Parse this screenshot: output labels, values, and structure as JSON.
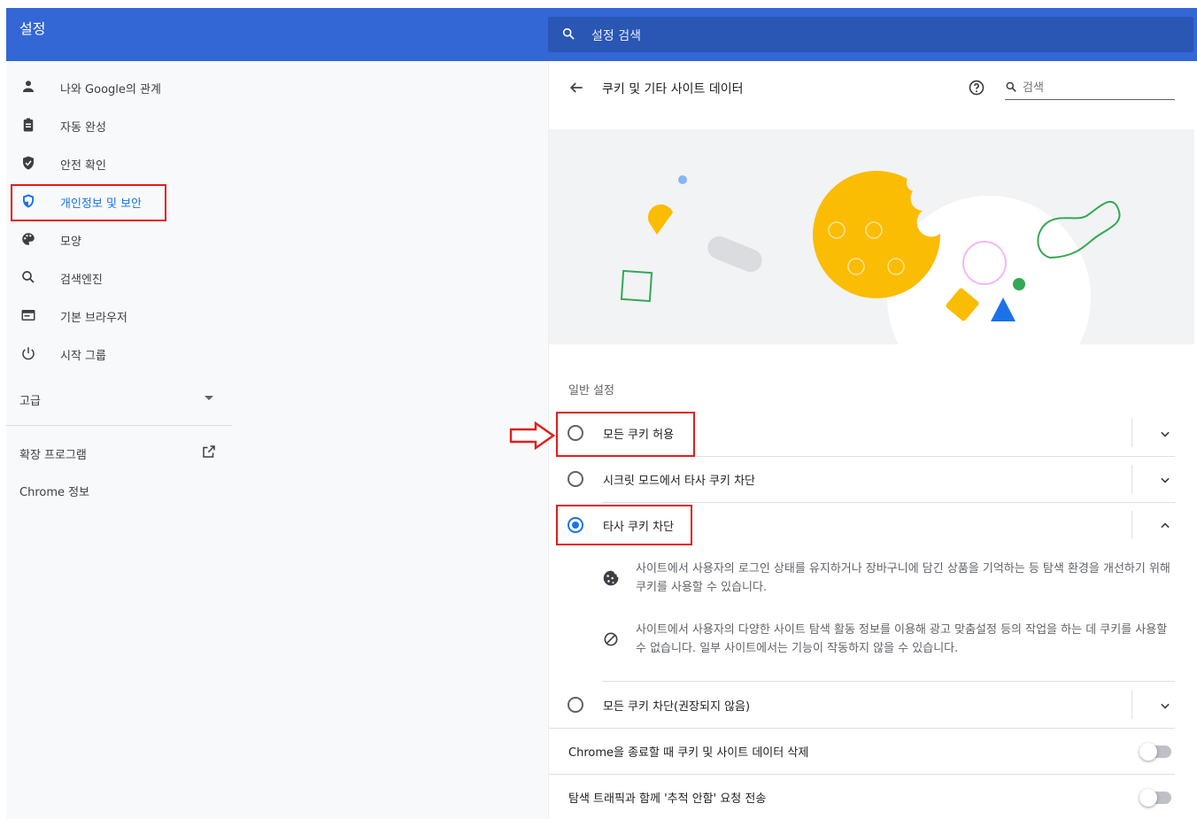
{
  "app": {
    "title": "설정"
  },
  "topbar": {
    "search_placeholder": "설정 검색",
    "search_icon": "search-icon"
  },
  "sidebar": {
    "items": [
      {
        "label": "나와 Google의 관계",
        "icon": "person-icon"
      },
      {
        "label": "자동 완성",
        "icon": "clipboard-icon"
      },
      {
        "label": "안전 확인",
        "icon": "shield-check-icon"
      },
      {
        "label": "개인정보 및 보안",
        "icon": "shield-icon",
        "active": true
      },
      {
        "label": "모양",
        "icon": "palette-icon"
      },
      {
        "label": "검색엔진",
        "icon": "search-icon"
      },
      {
        "label": "기본 브라우저",
        "icon": "browser-icon"
      },
      {
        "label": "시작 그룹",
        "icon": "power-icon"
      }
    ],
    "advanced": "고급",
    "extensions": "확장 프로그램",
    "about": "Chrome 정보"
  },
  "page": {
    "title": "쿠키 및 기타 사이트 데이터",
    "search_placeholder": "검색",
    "section_label": "일반 설정"
  },
  "options": [
    {
      "label": "모든 쿠키 허용",
      "checked": false,
      "expanded": false
    },
    {
      "label": "시크릿 모드에서 타사 쿠키 차단",
      "checked": false,
      "expanded": false
    },
    {
      "label": "타사 쿠키 차단",
      "checked": true,
      "expanded": true
    },
    {
      "label": "모든 쿠키 차단(권장되지 않음)",
      "checked": false,
      "expanded": false
    }
  ],
  "details": [
    {
      "icon": "cookie-icon",
      "text": "사이트에서 사용자의 로그인 상태를 유지하거나 장바구니에 담긴 상품을 기억하는 등 탐색 환경을 개선하기 위해 쿠키를 사용할 수 있습니다."
    },
    {
      "icon": "block-icon",
      "text": "사이트에서 사용자의 다양한 사이트 탐색 활동 정보를 이용해 광고 맞춤설정 등의 작업을 하는 데 쿠키를 사용할 수 없습니다. 일부 사이트에서는 기능이 작동하지 않을 수 있습니다."
    }
  ],
  "toggles": [
    {
      "label": "Chrome을 종료할 때 쿠키 및 사이트 데이터 삭제",
      "on": false
    },
    {
      "label": "탐색 트래픽과 함께 '추적 안함' 요청 전송",
      "on": false
    }
  ],
  "colors": {
    "header": "#3367d6",
    "accent": "#1a73e8",
    "annotation": "#e01e1e"
  }
}
